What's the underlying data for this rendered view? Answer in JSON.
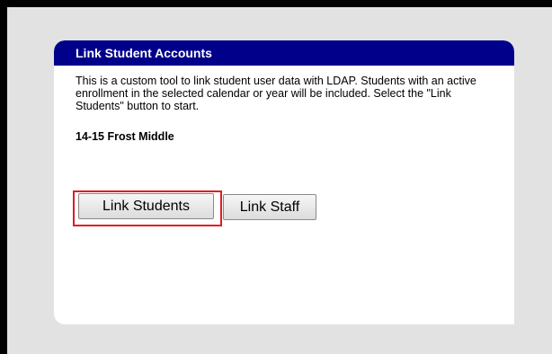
{
  "panel": {
    "title": "Link Student Accounts",
    "description": "This is a custom tool to link student user data with LDAP. Students with an active enrollment in the selected calendar or year will be included. Select the \"Link Students\" button to start.",
    "calendar_name": "14-15 Frost Middle"
  },
  "buttons": {
    "link_students_label": "Link Students",
    "link_staff_label": "Link Staff"
  },
  "colors": {
    "header_bg": "#00008b",
    "highlight": "#e01b24"
  }
}
